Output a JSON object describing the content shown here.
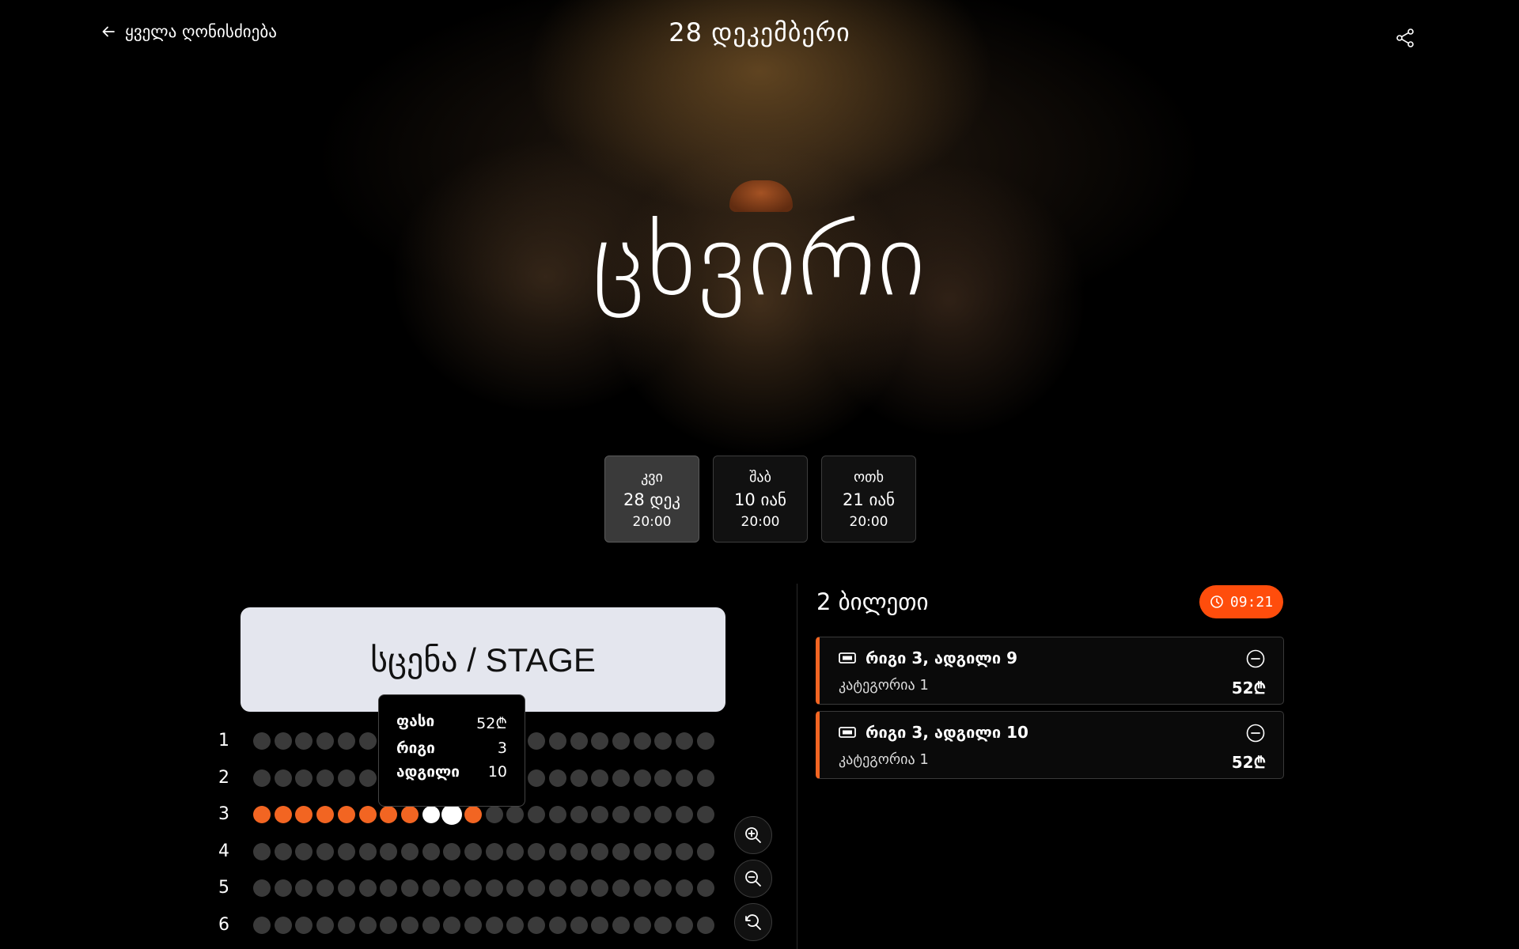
{
  "header": {
    "back_label": "ყველა ღონისძიება",
    "date_title": "28 დეკემბერი"
  },
  "event": {
    "title": "ცხვირი"
  },
  "dates": [
    {
      "dow": "კვი",
      "date": "28 დეკ",
      "time": "20:00",
      "active": true
    },
    {
      "dow": "შაბ",
      "date": "10 იან",
      "time": "20:00",
      "active": false
    },
    {
      "dow": "ოთხ",
      "date": "21 იან",
      "time": "20:00",
      "active": false
    }
  ],
  "stage_label": "სცენა / STAGE",
  "seatmap": {
    "rows": [
      "1",
      "2",
      "3",
      "4",
      "5",
      "6"
    ],
    "seats_per_row": 22,
    "taken": {
      "3": [
        1,
        2,
        3,
        4,
        5,
        6,
        7,
        8,
        11
      ]
    },
    "selected": {
      "3": [
        9,
        10
      ]
    },
    "hovered": {
      "row": "3",
      "seat": 10
    }
  },
  "tooltip": {
    "price_label": "ფასი",
    "price_value": "52₾",
    "row_label": "რიგი",
    "row_value": "3",
    "seat_label": "ადგილი",
    "seat_value": "10"
  },
  "zoom_icons": [
    "zoom-in-icon",
    "zoom-out-icon",
    "reset-zoom-icon"
  ],
  "cart": {
    "count_label": "2 ბილეთი",
    "timer": "09:21",
    "tickets": [
      {
        "title": "რიგი 3, ადგილი 9",
        "category": "კატეგორია 1",
        "price": "52₾"
      },
      {
        "title": "რიგი 3, ადგილი 10",
        "category": "კატეგორია 1",
        "price": "52₾"
      }
    ]
  },
  "colors": {
    "accent": "#f26522",
    "timer_bg": "#ff4d0c",
    "stage_bg": "#e4e6ee",
    "seat_free": "#3a3a3a"
  }
}
